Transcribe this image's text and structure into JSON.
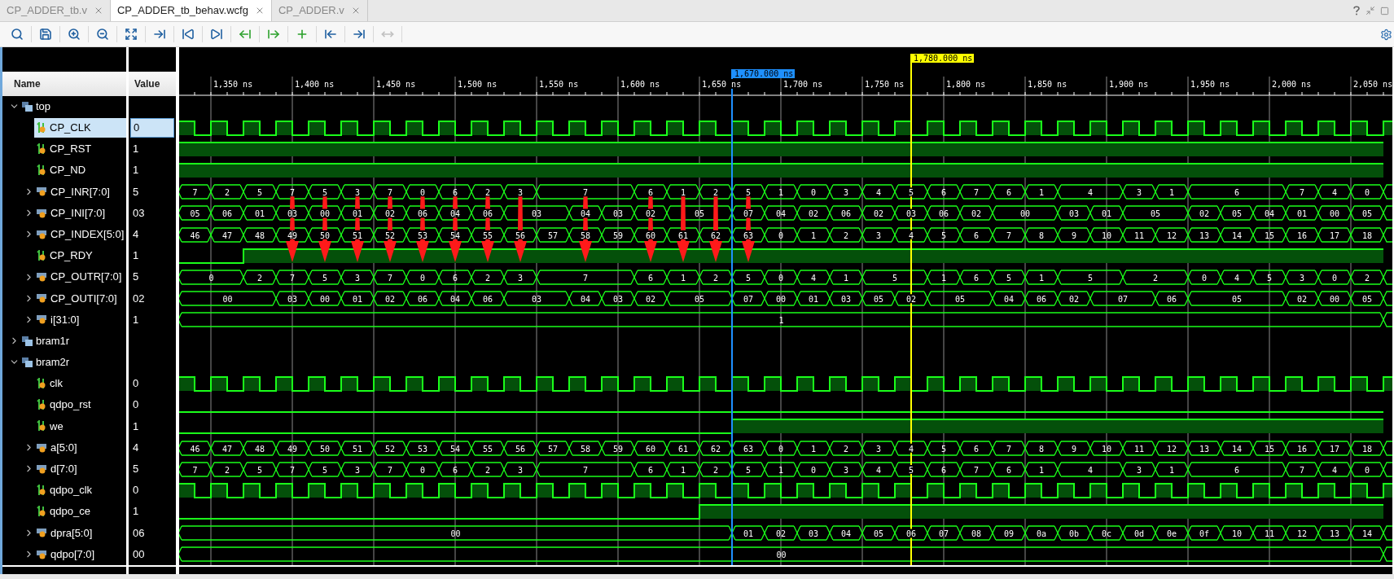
{
  "tabs": [
    {
      "label": "CP_ADDER_tb.v",
      "selected": false
    },
    {
      "label": "CP_ADDER_tb_behav.wcfg",
      "selected": true
    },
    {
      "label": "CP_ADDER.v",
      "selected": false
    }
  ],
  "columns": {
    "name": "Name",
    "value": "Value"
  },
  "cursors": [
    {
      "label": "1,780.000 ns",
      "color": "#ffff00"
    },
    {
      "label": "1,670.000 ns",
      "color": "#1e90ff"
    }
  ],
  "time_axis": {
    "ticks": [
      "1,350 ns",
      "1,400 ns",
      "1,450 ns",
      "1,500 ns",
      "1,550 ns",
      "1,600 ns",
      "1,650 ns",
      "1,700 ns",
      "1,750 ns",
      "1,800 ns",
      "1,850 ns",
      "1,900 ns",
      "1,950 ns",
      "2,000 ns",
      "2,050 ns"
    ]
  },
  "tree": [
    {
      "kind": "scope",
      "name": "top",
      "expanded": true,
      "selected": false,
      "children": [
        {
          "kind": "clock",
          "name": "CP_CLK",
          "value": "0",
          "selected": true
        },
        {
          "kind": "bit",
          "name": "CP_RST",
          "value": "1",
          "selected": false,
          "high": [
            true,
            true,
            true,
            true,
            true,
            true,
            true,
            true,
            true,
            true,
            true,
            true,
            true,
            true,
            true,
            true,
            true,
            true,
            true,
            true,
            true,
            true,
            true,
            true,
            true,
            true,
            true,
            true,
            true,
            true,
            true,
            true,
            true,
            true,
            true,
            true,
            true
          ]
        },
        {
          "kind": "bit",
          "name": "CP_ND",
          "value": "1",
          "selected": false,
          "high": [
            true,
            true,
            true,
            true,
            true,
            true,
            true,
            true,
            true,
            true,
            true,
            true,
            true,
            true,
            true,
            true,
            true,
            true,
            true,
            true,
            true,
            true,
            true,
            true,
            true,
            true,
            true,
            true,
            true,
            true,
            true,
            true,
            true,
            true,
            true,
            true,
            true
          ]
        },
        {
          "kind": "bus",
          "name": "CP_INR[7:0]",
          "value": "5",
          "selected": false,
          "expanded": false,
          "cycles": [
            {
              "value": "7",
              "held": false,
              "arrow": false
            },
            {
              "value": "2",
              "held": false,
              "arrow": false
            },
            {
              "value": "5",
              "held": false,
              "arrow": false
            },
            {
              "value": "7",
              "held": false,
              "arrow": true
            },
            {
              "value": "5",
              "held": false,
              "arrow": true
            },
            {
              "value": "3",
              "held": false,
              "arrow": true
            },
            {
              "value": "7",
              "held": false,
              "arrow": true
            },
            {
              "value": "0",
              "held": false,
              "arrow": true
            },
            {
              "value": "6",
              "held": false,
              "arrow": true
            },
            {
              "value": "2",
              "held": false,
              "arrow": true
            },
            {
              "value": "3",
              "held": false,
              "arrow": true
            },
            {
              "value": "7",
              "held": false,
              "arrow": true
            },
            {
              "held": true,
              "arrow": false
            },
            {
              "held": true,
              "arrow": false
            },
            {
              "value": "6",
              "held": false,
              "arrow": true
            },
            {
              "value": "1",
              "held": false,
              "arrow": true
            },
            {
              "value": "2",
              "held": false,
              "arrow": true
            },
            {
              "value": "5",
              "held": false,
              "arrow": true
            },
            {
              "value": "1",
              "held": false,
              "arrow": false
            },
            {
              "value": "0",
              "held": false,
              "arrow": false
            },
            {
              "value": "3",
              "held": false,
              "arrow": false
            },
            {
              "value": "4",
              "held": false,
              "arrow": false
            },
            {
              "value": "5",
              "held": false,
              "arrow": false
            },
            {
              "value": "6",
              "held": false,
              "arrow": false
            },
            {
              "value": "7",
              "held": false,
              "arrow": false
            },
            {
              "value": "6",
              "held": false,
              "arrow": false
            },
            {
              "value": "1",
              "held": false,
              "arrow": false
            },
            {
              "value": "4",
              "held": false,
              "arrow": false
            },
            {
              "held": true,
              "arrow": false
            },
            {
              "value": "3",
              "held": false,
              "arrow": false
            },
            {
              "value": "1",
              "held": false,
              "arrow": false
            },
            {
              "value": "6",
              "held": false,
              "arrow": false
            },
            {
              "held": true,
              "arrow": false
            },
            {
              "held": true,
              "arrow": false
            },
            {
              "value": "7",
              "held": false,
              "arrow": false
            },
            {
              "value": "4",
              "held": false,
              "arrow": false
            },
            {
              "value": "0",
              "held": false,
              "arrow": false
            }
          ]
        },
        {
          "kind": "bus",
          "name": "CP_INI[7:0]",
          "value": "03",
          "selected": false,
          "expanded": false,
          "cycles": [
            {
              "value": "05",
              "held": false
            },
            {
              "value": "06",
              "held": false
            },
            {
              "value": "01",
              "held": false
            },
            {
              "value": "03",
              "held": false
            },
            {
              "value": "00",
              "held": false
            },
            {
              "value": "01",
              "held": false
            },
            {
              "value": "02",
              "held": false
            },
            {
              "value": "06",
              "held": false
            },
            {
              "value": "04",
              "held": false
            },
            {
              "value": "06",
              "held": false
            },
            {
              "value": "03",
              "held": false
            },
            {
              "held": true
            },
            {
              "value": "04",
              "held": false
            },
            {
              "value": "03",
              "held": false
            },
            {
              "value": "02",
              "held": false
            },
            {
              "value": "05",
              "held": false
            },
            {
              "held": true
            },
            {
              "value": "07",
              "held": false
            },
            {
              "value": "04",
              "held": false
            },
            {
              "value": "02",
              "held": false
            },
            {
              "value": "06",
              "held": false
            },
            {
              "value": "02",
              "held": false
            },
            {
              "value": "03",
              "held": false
            },
            {
              "value": "06",
              "held": false
            },
            {
              "value": "02",
              "held": false
            },
            {
              "value": "00",
              "held": false
            },
            {
              "held": true
            },
            {
              "value": "03",
              "held": false
            },
            {
              "value": "01",
              "held": false
            },
            {
              "value": "05",
              "held": false
            },
            {
              "held": true
            },
            {
              "value": "02",
              "held": false
            },
            {
              "value": "05",
              "held": false
            },
            {
              "value": "04",
              "held": false
            },
            {
              "value": "01",
              "held": false
            },
            {
              "value": "00",
              "held": false
            },
            {
              "value": "05",
              "held": false
            }
          ]
        },
        {
          "kind": "bus",
          "name": "CP_INDEX[5:0]",
          "value": "4",
          "selected": false,
          "expanded": false,
          "cycles": [
            {
              "value": "46",
              "held": false
            },
            {
              "value": "47",
              "held": false
            },
            {
              "value": "48",
              "held": false
            },
            {
              "value": "49",
              "held": false
            },
            {
              "value": "50",
              "held": false
            },
            {
              "value": "51",
              "held": false
            },
            {
              "value": "52",
              "held": false
            },
            {
              "value": "53",
              "held": false
            },
            {
              "value": "54",
              "held": false
            },
            {
              "value": "55",
              "held": false
            },
            {
              "value": "56",
              "held": false
            },
            {
              "value": "57",
              "held": false
            },
            {
              "value": "58",
              "held": false
            },
            {
              "value": "59",
              "held": false
            },
            {
              "value": "60",
              "held": false
            },
            {
              "value": "61",
              "held": false
            },
            {
              "value": "62",
              "held": false
            },
            {
              "value": "63",
              "held": false
            },
            {
              "value": "0",
              "held": false
            },
            {
              "value": "1",
              "held": false
            },
            {
              "value": "2",
              "held": false
            },
            {
              "value": "3",
              "held": false
            },
            {
              "value": "4",
              "held": false
            },
            {
              "value": "5",
              "held": false
            },
            {
              "value": "6",
              "held": false
            },
            {
              "value": "7",
              "held": false
            },
            {
              "value": "8",
              "held": false
            },
            {
              "value": "9",
              "held": false
            },
            {
              "value": "10",
              "held": false
            },
            {
              "value": "11",
              "held": false
            },
            {
              "value": "12",
              "held": false
            },
            {
              "value": "13",
              "held": false
            },
            {
              "value": "14",
              "held": false
            },
            {
              "value": "15",
              "held": false
            },
            {
              "value": "16",
              "held": false
            },
            {
              "value": "17",
              "held": false
            },
            {
              "value": "18",
              "held": false
            }
          ]
        },
        {
          "kind": "bit",
          "name": "CP_RDY",
          "value": "1",
          "selected": false,
          "high": [
            false,
            false,
            true,
            true,
            true,
            true,
            true,
            true,
            true,
            true,
            true,
            true,
            true,
            true,
            true,
            true,
            true,
            true,
            true,
            true,
            true,
            true,
            true,
            true,
            true,
            true,
            true,
            true,
            true,
            true,
            true,
            true,
            true,
            true,
            true,
            true,
            true
          ]
        },
        {
          "kind": "bus",
          "name": "CP_OUTR[7:0]",
          "value": "5",
          "selected": false,
          "expanded": false,
          "cycles": [
            {
              "value": "0",
              "held": false
            },
            {
              "held": true
            },
            {
              "value": "2",
              "held": false
            },
            {
              "value": "7",
              "held": false
            },
            {
              "value": "5",
              "held": false
            },
            {
              "value": "3",
              "held": false
            },
            {
              "value": "7",
              "held": false
            },
            {
              "value": "0",
              "held": false
            },
            {
              "value": "6",
              "held": false
            },
            {
              "value": "2",
              "held": false
            },
            {
              "value": "3",
              "held": false
            },
            {
              "value": "7",
              "held": false
            },
            {
              "held": true
            },
            {
              "held": true
            },
            {
              "value": "6",
              "held": false
            },
            {
              "value": "1",
              "held": false
            },
            {
              "value": "2",
              "held": false
            },
            {
              "value": "5",
              "held": false
            },
            {
              "value": "0",
              "held": false
            },
            {
              "value": "4",
              "held": false
            },
            {
              "value": "1",
              "held": false
            },
            {
              "value": "5",
              "held": false
            },
            {
              "held": true
            },
            {
              "value": "1",
              "held": false
            },
            {
              "value": "6",
              "held": false
            },
            {
              "value": "5",
              "held": false
            },
            {
              "value": "1",
              "held": false
            },
            {
              "value": "5",
              "held": false
            },
            {
              "held": true
            },
            {
              "value": "2",
              "held": false
            },
            {
              "held": true
            },
            {
              "value": "0",
              "held": false
            },
            {
              "value": "4",
              "held": false
            },
            {
              "value": "5",
              "held": false
            },
            {
              "value": "3",
              "held": false
            },
            {
              "value": "0",
              "held": false
            },
            {
              "value": "2",
              "held": false
            }
          ]
        },
        {
          "kind": "bus",
          "name": "CP_OUTI[7:0]",
          "value": "02",
          "selected": false,
          "expanded": false,
          "cycles": [
            {
              "value": "00",
              "held": false
            },
            {
              "held": true
            },
            {
              "held": true
            },
            {
              "value": "03",
              "held": false
            },
            {
              "value": "00",
              "held": false
            },
            {
              "value": "01",
              "held": false
            },
            {
              "value": "02",
              "held": false
            },
            {
              "value": "06",
              "held": false
            },
            {
              "value": "04",
              "held": false
            },
            {
              "value": "06",
              "held": false
            },
            {
              "value": "03",
              "held": false
            },
            {
              "held": true
            },
            {
              "value": "04",
              "held": false
            },
            {
              "value": "03",
              "held": false
            },
            {
              "value": "02",
              "held": false
            },
            {
              "value": "05",
              "held": false
            },
            {
              "held": true
            },
            {
              "value": "07",
              "held": false
            },
            {
              "value": "00",
              "held": false
            },
            {
              "value": "01",
              "held": false
            },
            {
              "value": "03",
              "held": false
            },
            {
              "value": "05",
              "held": false
            },
            {
              "value": "02",
              "held": false
            },
            {
              "value": "05",
              "held": false
            },
            {
              "held": true
            },
            {
              "value": "04",
              "held": false
            },
            {
              "value": "06",
              "held": false
            },
            {
              "value": "02",
              "held": false
            },
            {
              "value": "07",
              "held": false
            },
            {
              "held": true
            },
            {
              "value": "06",
              "held": false
            },
            {
              "value": "05",
              "held": false
            },
            {
              "held": true
            },
            {
              "held": true
            },
            {
              "value": "02",
              "held": false
            },
            {
              "value": "00",
              "held": false
            },
            {
              "value": "05",
              "held": false
            }
          ]
        },
        {
          "kind": "bus",
          "name": "i[31:0]",
          "value": "1",
          "selected": false,
          "expanded": false,
          "cycles": [
            {
              "value": "1",
              "held": false
            },
            {
              "held": true
            },
            {
              "held": true
            },
            {
              "held": true
            },
            {
              "held": true
            },
            {
              "held": true
            },
            {
              "held": true
            },
            {
              "held": true
            },
            {
              "held": true
            },
            {
              "held": true
            },
            {
              "held": true
            },
            {
              "held": true
            },
            {
              "held": true
            },
            {
              "held": true
            },
            {
              "held": true
            },
            {
              "held": true
            },
            {
              "held": true
            },
            {
              "held": true
            },
            {
              "held": true
            },
            {
              "held": true
            },
            {
              "held": true
            },
            {
              "held": true
            },
            {
              "held": true
            },
            {
              "held": true
            },
            {
              "held": true
            },
            {
              "held": true
            },
            {
              "held": true
            },
            {
              "held": true
            },
            {
              "held": true
            },
            {
              "held": true
            },
            {
              "held": true
            },
            {
              "held": true
            },
            {
              "held": true
            },
            {
              "held": true
            },
            {
              "held": true
            },
            {
              "held": true
            },
            {
              "held": true
            }
          ]
        }
      ]
    },
    {
      "kind": "scope",
      "name": "bram1r",
      "expanded": false,
      "selected": false
    },
    {
      "kind": "scope",
      "name": "bram2r",
      "expanded": true,
      "selected": false,
      "children": [
        {
          "kind": "clock",
          "name": "clk",
          "value": "0",
          "selected": false
        },
        {
          "kind": "bit",
          "name": "qdpo_rst",
          "value": "0",
          "selected": false,
          "high": [
            false,
            false,
            false,
            false,
            false,
            false,
            false,
            false,
            false,
            false,
            false,
            false,
            false,
            false,
            false,
            false,
            false,
            false,
            false,
            false,
            false,
            false,
            false,
            false,
            false,
            false,
            false,
            false,
            false,
            false,
            false,
            false,
            false,
            false,
            false,
            false,
            false
          ]
        },
        {
          "kind": "bit",
          "name": "we",
          "value": "1",
          "selected": false,
          "high": [
            false,
            false,
            false,
            false,
            false,
            false,
            false,
            false,
            false,
            false,
            false,
            false,
            false,
            false,
            false,
            false,
            false,
            true,
            true,
            true,
            true,
            true,
            true,
            true,
            true,
            true,
            true,
            true,
            true,
            true,
            true,
            true,
            true,
            true,
            true,
            true,
            true
          ]
        },
        {
          "kind": "bus",
          "name": "a[5:0]",
          "value": "4",
          "selected": false,
          "expanded": false,
          "cycles": [
            {
              "value": "46",
              "held": false
            },
            {
              "value": "47",
              "held": false
            },
            {
              "value": "48",
              "held": false
            },
            {
              "value": "49",
              "held": false
            },
            {
              "value": "50",
              "held": false
            },
            {
              "value": "51",
              "held": false
            },
            {
              "value": "52",
              "held": false
            },
            {
              "value": "53",
              "held": false
            },
            {
              "value": "54",
              "held": false
            },
            {
              "value": "55",
              "held": false
            },
            {
              "value": "56",
              "held": false
            },
            {
              "value": "57",
              "held": false
            },
            {
              "value": "58",
              "held": false
            },
            {
              "value": "59",
              "held": false
            },
            {
              "value": "60",
              "held": false
            },
            {
              "value": "61",
              "held": false
            },
            {
              "value": "62",
              "held": false
            },
            {
              "value": "63",
              "held": false
            },
            {
              "value": "0",
              "held": false
            },
            {
              "value": "1",
              "held": false
            },
            {
              "value": "2",
              "held": false
            },
            {
              "value": "3",
              "held": false
            },
            {
              "value": "4",
              "held": false
            },
            {
              "value": "5",
              "held": false
            },
            {
              "value": "6",
              "held": false
            },
            {
              "value": "7",
              "held": false
            },
            {
              "value": "8",
              "held": false
            },
            {
              "value": "9",
              "held": false
            },
            {
              "value": "10",
              "held": false
            },
            {
              "value": "11",
              "held": false
            },
            {
              "value": "12",
              "held": false
            },
            {
              "value": "13",
              "held": false
            },
            {
              "value": "14",
              "held": false
            },
            {
              "value": "15",
              "held": false
            },
            {
              "value": "16",
              "held": false
            },
            {
              "value": "17",
              "held": false
            },
            {
              "value": "18",
              "held": false
            }
          ]
        },
        {
          "kind": "bus",
          "name": "d[7:0]",
          "value": "5",
          "selected": false,
          "expanded": false,
          "cycles": [
            {
              "value": "7",
              "held": false
            },
            {
              "value": "2",
              "held": false
            },
            {
              "value": "5",
              "held": false
            },
            {
              "value": "7",
              "held": false
            },
            {
              "value": "5",
              "held": false
            },
            {
              "value": "3",
              "held": false
            },
            {
              "value": "7",
              "held": false
            },
            {
              "value": "0",
              "held": false
            },
            {
              "value": "6",
              "held": false
            },
            {
              "value": "2",
              "held": false
            },
            {
              "value": "3",
              "held": false
            },
            {
              "value": "7",
              "held": false
            },
            {
              "held": true
            },
            {
              "held": true
            },
            {
              "value": "6",
              "held": false
            },
            {
              "value": "1",
              "held": false
            },
            {
              "value": "2",
              "held": false
            },
            {
              "value": "5",
              "held": false
            },
            {
              "value": "1",
              "held": false
            },
            {
              "value": "0",
              "held": false
            },
            {
              "value": "3",
              "held": false
            },
            {
              "value": "4",
              "held": false
            },
            {
              "value": "5",
              "held": false
            },
            {
              "value": "6",
              "held": false
            },
            {
              "value": "7",
              "held": false
            },
            {
              "value": "6",
              "held": false
            },
            {
              "value": "1",
              "held": false
            },
            {
              "value": "4",
              "held": false
            },
            {
              "held": true
            },
            {
              "value": "3",
              "held": false
            },
            {
              "value": "1",
              "held": false
            },
            {
              "value": "6",
              "held": false
            },
            {
              "held": true
            },
            {
              "held": true
            },
            {
              "value": "7",
              "held": false
            },
            {
              "value": "4",
              "held": false
            },
            {
              "value": "0",
              "held": false
            }
          ]
        },
        {
          "kind": "clock",
          "name": "qdpo_clk",
          "value": "0",
          "selected": false
        },
        {
          "kind": "bit",
          "name": "qdpo_ce",
          "value": "1",
          "selected": false,
          "high": [
            false,
            false,
            false,
            false,
            false,
            false,
            false,
            false,
            false,
            false,
            false,
            false,
            false,
            false,
            false,
            false,
            true,
            true,
            true,
            true,
            true,
            true,
            true,
            true,
            true,
            true,
            true,
            true,
            true,
            true,
            true,
            true,
            true,
            true,
            true,
            true,
            true
          ]
        },
        {
          "kind": "bus",
          "name": "dpra[5:0]",
          "value": "06",
          "selected": false,
          "expanded": false,
          "cycles": [
            {
              "value": "00",
              "held": false
            },
            {
              "held": true
            },
            {
              "held": true
            },
            {
              "held": true
            },
            {
              "held": true
            },
            {
              "held": true
            },
            {
              "held": true
            },
            {
              "held": true
            },
            {
              "held": true
            },
            {
              "held": true
            },
            {
              "held": true
            },
            {
              "held": true
            },
            {
              "held": true
            },
            {
              "held": true
            },
            {
              "held": true
            },
            {
              "held": true
            },
            {
              "held": true
            },
            {
              "value": "01",
              "held": false
            },
            {
              "value": "02",
              "held": false
            },
            {
              "value": "03",
              "held": false
            },
            {
              "value": "04",
              "held": false
            },
            {
              "value": "05",
              "held": false
            },
            {
              "value": "06",
              "held": false
            },
            {
              "value": "07",
              "held": false
            },
            {
              "value": "08",
              "held": false
            },
            {
              "value": "09",
              "held": false
            },
            {
              "value": "0a",
              "held": false
            },
            {
              "value": "0b",
              "held": false
            },
            {
              "value": "0c",
              "held": false
            },
            {
              "value": "0d",
              "held": false
            },
            {
              "value": "0e",
              "held": false
            },
            {
              "value": "0f",
              "held": false
            },
            {
              "value": "10",
              "held": false
            },
            {
              "value": "11",
              "held": false
            },
            {
              "value": "12",
              "held": false
            },
            {
              "value": "13",
              "held": false
            },
            {
              "value": "14",
              "held": false
            }
          ]
        },
        {
          "kind": "bus",
          "name": "qdpo[7:0]",
          "value": "00",
          "selected": false,
          "expanded": false,
          "cycles": [
            {
              "value": "00",
              "held": false
            },
            {
              "held": true
            },
            {
              "held": true
            },
            {
              "held": true
            },
            {
              "held": true
            },
            {
              "held": true
            },
            {
              "held": true
            },
            {
              "held": true
            },
            {
              "held": true
            },
            {
              "held": true
            },
            {
              "held": true
            },
            {
              "held": true
            },
            {
              "held": true
            },
            {
              "held": true
            },
            {
              "held": true
            },
            {
              "held": true
            },
            {
              "held": true
            },
            {
              "held": true
            },
            {
              "held": true
            },
            {
              "held": true
            },
            {
              "held": true
            },
            {
              "held": true
            },
            {
              "held": true
            },
            {
              "held": true
            },
            {
              "held": true
            },
            {
              "held": true
            },
            {
              "held": true
            },
            {
              "held": true
            },
            {
              "held": true
            },
            {
              "held": true
            },
            {
              "held": true
            },
            {
              "held": true
            },
            {
              "held": true
            },
            {
              "held": true
            },
            {
              "held": true
            },
            {
              "held": true
            },
            {
              "held": true
            }
          ]
        }
      ]
    }
  ]
}
